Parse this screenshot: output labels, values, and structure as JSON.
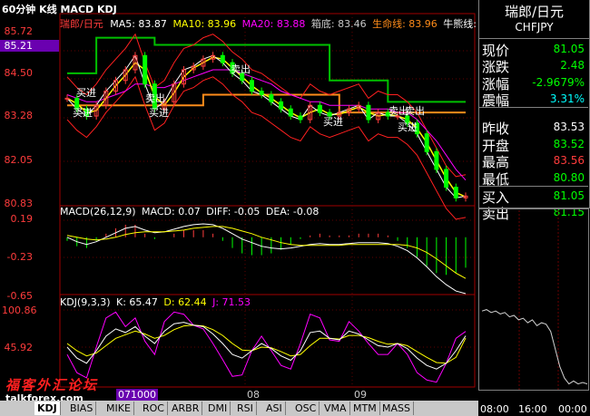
{
  "window": {
    "title": "60分钟 K线 MACD KDJ"
  },
  "header": {
    "symbol": "瑞郎/日元",
    "ma5": "MA5: 83.87",
    "ma10": "MA10: 83.96",
    "ma20": "MA20: 83.88",
    "box_bottom": "箱底: 83.46",
    "life_line": "生命线: 83.96",
    "bull_line": "牛熊线: 83"
  },
  "price_axis": [
    "85.72",
    "85.21",
    "84.50",
    "83.28",
    "82.05",
    "80.83"
  ],
  "macd": {
    "title": "MACD(26,12,9)",
    "macd": "MACD: 0.07",
    "diff": "DIFF: -0.05",
    "dea": "DEA: -0.08",
    "axis": [
      "0.19",
      "-0.23",
      "-0.65"
    ]
  },
  "kdj": {
    "title": "KDJ(9,3,3)",
    "k": "K: 65.47",
    "d": "D: 62.44",
    "j": "J: 71.53",
    "axis": [
      "100.86",
      "45.92"
    ]
  },
  "annotations": {
    "buy": "买进",
    "sell": "卖出"
  },
  "time_axis": [
    "071000",
    "08",
    "09"
  ],
  "tabs": [
    "BIAS",
    "MIKE",
    "ROC",
    "ARBR",
    "DMI",
    "RSI",
    "ASI",
    "OSC",
    "VMA",
    "MTM",
    "MASS"
  ],
  "tab_active": "KDJ",
  "watermark": {
    "line1": "福客外汇论坛",
    "line2": "talkforex.com"
  },
  "panel": {
    "title": "瑞郎/日元",
    "code": "CHFJPY",
    "rows": [
      {
        "label": "现价",
        "value": "81.05",
        "color": "#00ff00"
      },
      {
        "label": "涨跌",
        "value": "2.48",
        "color": "#00ff00"
      },
      {
        "label": "涨幅",
        "value": "-2.9679%",
        "color": "#00ff00"
      },
      {
        "label": "震幅",
        "value": "3.31%",
        "color": "#00ffff"
      },
      {
        "label": "昨收",
        "value": "83.53",
        "color": "#ffffff"
      },
      {
        "label": "开盘",
        "value": "83.52",
        "color": "#00ff00"
      },
      {
        "label": "最高",
        "value": "83.56",
        "color": "#ff3c3c"
      },
      {
        "label": "最低",
        "value": "80.80",
        "color": "#00ff00"
      },
      {
        "label": "买入",
        "value": "81.05",
        "color": "#00ff00"
      },
      {
        "label": "卖出",
        "value": "81.15",
        "color": "#00ff00"
      }
    ],
    "time_axis": [
      "08:00",
      "16:00",
      "00:00"
    ]
  },
  "colors": {
    "up": "#ff3c3c",
    "down": "#00ff00",
    "ma5": "#ffffff",
    "ma10": "#ffff00",
    "ma20": "#ff00ff",
    "boll": "#ff2020",
    "box": "#00c000",
    "life": "#ff8c1a",
    "kdj_k": "#ffffff",
    "kdj_d": "#ffff00",
    "kdj_j": "#ff00ff"
  },
  "chart_data": {
    "type": "line",
    "title": "60分钟 K线 MACD KDJ",
    "price_range": [
      80.83,
      85.72
    ],
    "price_series": {
      "close": [
        83.8,
        83.5,
        83.3,
        83.6,
        84.0,
        84.3,
        84.6,
        85.0,
        84.2,
        83.5,
        83.7,
        84.2,
        84.6,
        84.7,
        84.9,
        85.0,
        84.8,
        84.5,
        84.3,
        84.0,
        83.9,
        83.7,
        83.5,
        83.3,
        83.2,
        83.6,
        83.4,
        83.3,
        83.4,
        83.5,
        83.6,
        83.2,
        83.4,
        83.3,
        83.3,
        83.1,
        82.8,
        82.3,
        81.8,
        81.3,
        81.0,
        81.05
      ],
      "ma20": [
        83.9,
        83.8,
        83.7,
        83.7,
        83.8,
        83.9,
        84.0,
        84.2,
        84.2,
        84.1,
        84.1,
        84.2,
        84.3,
        84.4,
        84.5,
        84.6,
        84.6,
        84.6,
        84.5,
        84.4,
        84.3,
        84.2,
        84.0,
        83.9,
        83.8,
        83.7,
        83.7,
        83.6,
        83.6,
        83.6,
        83.6,
        83.5,
        83.5,
        83.5,
        83.4,
        83.4,
        83.2,
        82.9,
        82.6,
        82.2,
        81.8,
        81.5
      ],
      "box_top": [
        84.5,
        84.5,
        84.5,
        85.5,
        85.5,
        85.5,
        85.5,
        85.5,
        85.5,
        85.3,
        85.3,
        85.3,
        85.3,
        85.3,
        85.3,
        85.3,
        85.3,
        85.3,
        85.3,
        85.3,
        85.3,
        85.3,
        85.3,
        85.3,
        85.3,
        85.3,
        85.3,
        84.3,
        84.3,
        84.3,
        84.3,
        84.3,
        84.3,
        83.7,
        83.7,
        83.7,
        83.7,
        83.7,
        83.7,
        83.7,
        83.7,
        83.7
      ],
      "life_line": [
        83.6,
        83.6,
        83.6,
        83.6,
        83.6,
        83.6,
        83.6,
        83.6,
        83.6,
        83.6,
        83.6,
        83.6,
        83.6,
        83.6,
        83.9,
        83.9,
        83.9,
        83.9,
        83.9,
        83.9,
        83.9,
        83.9,
        83.9,
        83.9,
        83.9,
        83.9,
        83.9,
        83.9,
        83.4,
        83.4,
        83.4,
        83.4,
        83.4,
        83.4,
        83.4,
        83.4,
        83.4,
        83.4,
        83.4,
        83.4,
        83.4,
        83.4
      ]
    },
    "macd": {
      "range": [
        -0.65,
        0.19
      ],
      "diff": [
        0.0,
        -0.05,
        -0.08,
        -0.05,
        0.0,
        0.05,
        0.1,
        0.12,
        0.08,
        0.05,
        0.06,
        0.09,
        0.12,
        0.14,
        0.15,
        0.14,
        0.1,
        0.04,
        -0.02,
        -0.06,
        -0.1,
        -0.12,
        -0.13,
        -0.12,
        -0.1,
        -0.08,
        -0.07,
        -0.08,
        -0.08,
        -0.07,
        -0.06,
        -0.06,
        -0.06,
        -0.07,
        -0.1,
        -0.15,
        -0.23,
        -0.33,
        -0.44,
        -0.53,
        -0.6,
        -0.63
      ],
      "dea": [
        0.02,
        0.0,
        -0.02,
        -0.03,
        -0.02,
        0.0,
        0.03,
        0.05,
        0.06,
        0.06,
        0.06,
        0.07,
        0.08,
        0.1,
        0.11,
        0.12,
        0.12,
        0.1,
        0.07,
        0.04,
        0.0,
        -0.03,
        -0.06,
        -0.08,
        -0.09,
        -0.09,
        -0.09,
        -0.09,
        -0.09,
        -0.08,
        -0.08,
        -0.08,
        -0.08,
        -0.08,
        -0.08,
        -0.09,
        -0.12,
        -0.17,
        -0.24,
        -0.32,
        -0.4,
        -0.46
      ],
      "hist": [
        -0.04,
        -0.1,
        -0.12,
        -0.04,
        0.04,
        0.1,
        0.14,
        0.14,
        0.04,
        -0.02,
        0.0,
        0.04,
        0.08,
        0.08,
        0.08,
        0.04,
        -0.04,
        -0.12,
        -0.18,
        -0.2,
        -0.2,
        -0.18,
        -0.14,
        -0.08,
        -0.02,
        0.02,
        0.04,
        0.02,
        0.02,
        0.02,
        0.04,
        0.04,
        0.04,
        0.02,
        -0.04,
        -0.12,
        -0.22,
        -0.32,
        -0.4,
        -0.42,
        -0.4,
        -0.34
      ]
    },
    "kdj": {
      "range": [
        0,
        100.86
      ],
      "k": [
        50,
        35,
        28,
        45,
        65,
        75,
        70,
        78,
        65,
        55,
        72,
        82,
        84,
        80,
        78,
        68,
        55,
        40,
        35,
        45,
        55,
        48,
        38,
        32,
        45,
        70,
        72,
        62,
        60,
        72,
        68,
        60,
        52,
        50,
        55,
        48,
        35,
        25,
        20,
        28,
        45,
        65.47
      ],
      "d": [
        55,
        45,
        38,
        42,
        52,
        62,
        67,
        72,
        68,
        62,
        66,
        74,
        79,
        80,
        79,
        74,
        66,
        55,
        46,
        45,
        50,
        49,
        44,
        38,
        40,
        52,
        62,
        62,
        61,
        66,
        66,
        63,
        58,
        54,
        55,
        52,
        44,
        36,
        29,
        28,
        36,
        62.44
      ],
      "j": [
        40,
        15,
        8,
        50,
        90,
        98,
        78,
        90,
        58,
        40,
        85,
        98,
        95,
        80,
        75,
        55,
        33,
        10,
        12,
        45,
        65,
        45,
        25,
        20,
        55,
        95,
        90,
        60,
        58,
        85,
        72,
        55,
        40,
        40,
        55,
        40,
        15,
        5,
        2,
        28,
        62,
        71.53
      ]
    }
  }
}
